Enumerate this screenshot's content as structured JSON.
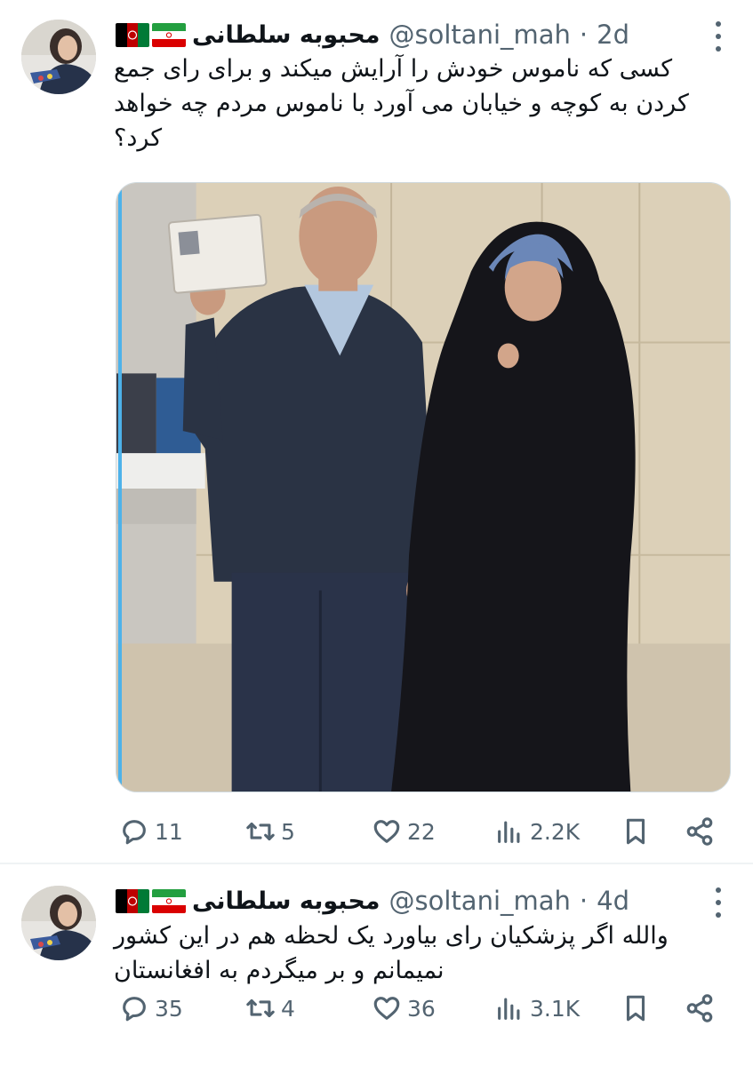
{
  "tweets": [
    {
      "author_name": "محبوبه سلطانی",
      "handle": "@soltani_mah",
      "separator": "·",
      "time": "2d",
      "text": "کسی که ناموس خودش را آرایش میکند و برای رای جمع کردن به کوچه و خیابان می آورد با ناموس مردم چه خواهد کرد؟",
      "has_media": true,
      "media_icon": "photo-of-two-people",
      "stats": {
        "replies": "11",
        "retweets": "5",
        "likes": "22",
        "views": "2.2K"
      }
    },
    {
      "author_name": "محبوبه سلطانی",
      "handle": "@soltani_mah",
      "separator": "·",
      "time": "4d",
      "text": "والله اگر پزشکیان رای بیاورد یک لحظه هم در این کشور نمیمانم و بر میگردم به افغانستان",
      "has_media": false,
      "stats": {
        "replies": "35",
        "retweets": "4",
        "likes": "36",
        "views": "3.1K"
      }
    }
  ],
  "flags": [
    "afghanistan-flag-icon",
    "iran-flag-icon"
  ],
  "icons": {
    "reply": "reply-icon",
    "retweet": "retweet-icon",
    "like": "heart-icon",
    "views": "views-icon",
    "bookmark": "bookmark-icon",
    "share": "share-icon",
    "more": "more-icon"
  },
  "colors": {
    "text": "#0f1419",
    "secondary": "#536471",
    "border": "#eff3f4",
    "flag_green_af": "#007a36",
    "flag_red_af": "#be0000",
    "flag_green_ir": "#239f40",
    "flag_red_ir": "#da0000"
  }
}
